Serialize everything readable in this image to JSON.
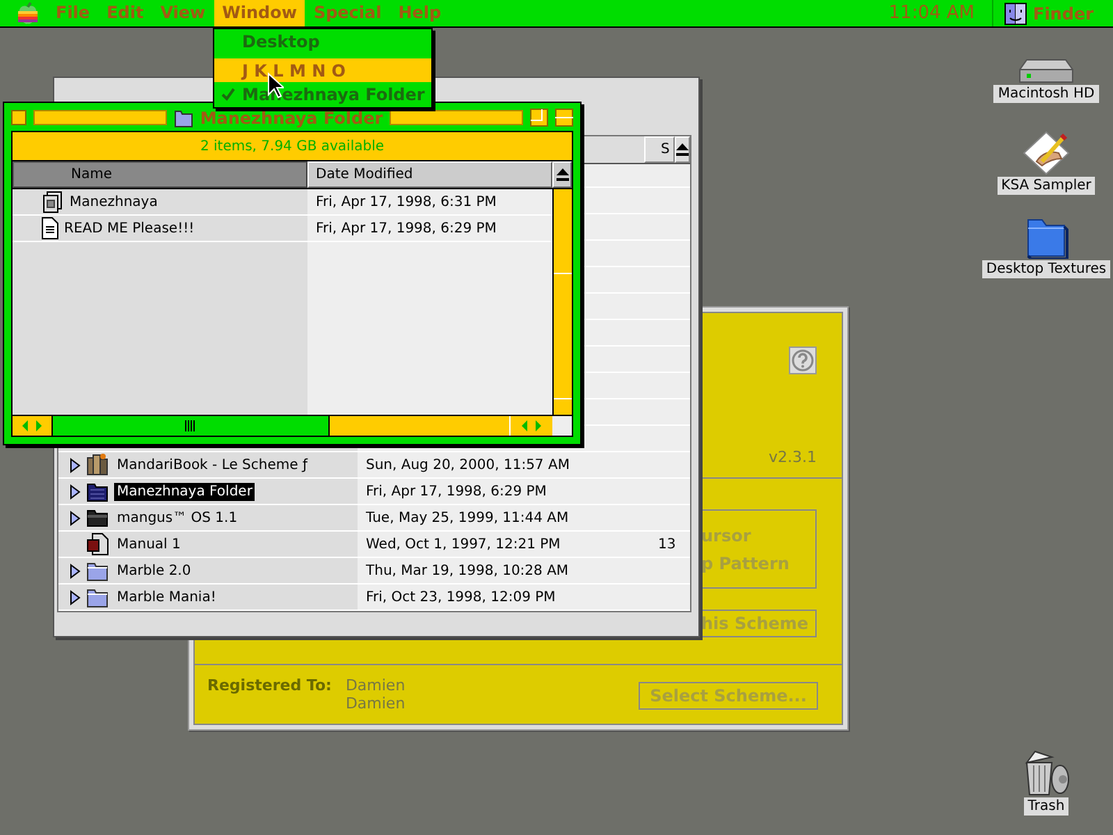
{
  "menu_bar": {
    "menus": [
      {
        "label": "File",
        "selected": false
      },
      {
        "label": "Edit",
        "selected": false
      },
      {
        "label": "View",
        "selected": false
      },
      {
        "label": "Window",
        "selected": true
      },
      {
        "label": "Special",
        "selected": false
      },
      {
        "label": "Help",
        "selected": false
      }
    ],
    "clock": "11:04 AM",
    "application": "Finder"
  },
  "window_menu": {
    "items": [
      {
        "label": "Desktop",
        "selected": false,
        "checked": false
      },
      {
        "label": "J K L M N O",
        "selected": true,
        "checked": false
      },
      {
        "label": "Manezhnaya Folder",
        "selected": false,
        "checked": true
      }
    ]
  },
  "folder_window": {
    "title": "Manezhnaya Folder",
    "info": "2 items, 7.94 GB available",
    "columns": [
      {
        "label": "Name",
        "selected": true
      },
      {
        "label": "Date Modified",
        "selected": false
      }
    ],
    "rows": [
      {
        "name": "Manezhnaya",
        "date": "Fri, Apr 17, 1998, 6:31 PM",
        "kind": "stack"
      },
      {
        "name": "READ ME Please!!!",
        "date": "Fri, Apr 17, 1998, 6:29 PM",
        "kind": "text"
      }
    ]
  },
  "list_window": {
    "column_3_header": "S",
    "rows": [
      {
        "name": "MandariBook - Le Scheme ƒ",
        "date": "Sun, Aug 20, 2000, 11:57 AM",
        "kind": "books",
        "expandable": true,
        "selected": false
      },
      {
        "name": "Manezhnaya Folder",
        "date": "Fri, Apr 17, 1998, 6:29 PM",
        "kind": "dark-folder",
        "expandable": true,
        "selected": true
      },
      {
        "name": "mangus™ OS 1.1",
        "date": "Tue, May 25, 1999, 11:44 AM",
        "kind": "black-folder",
        "expandable": true,
        "selected": false
      },
      {
        "name": "Manual 1",
        "date": "Wed, Oct 1, 1997, 12:21 PM",
        "column_3": "13",
        "kind": "document",
        "expandable": false,
        "selected": false
      },
      {
        "name": "Marble 2.0",
        "date": "Thu, Mar 19, 1998, 10:28 AM",
        "kind": "folder",
        "expandable": true,
        "selected": false
      },
      {
        "name": "Marble Mania!",
        "date": "Fri, Oct 23, 1998, 12:09 PM",
        "kind": "folder",
        "expandable": true,
        "selected": false
      }
    ]
  },
  "scheme_panel": {
    "version": "v2.3.1",
    "options": [
      "ursor",
      "p Pattern"
    ],
    "apply_button": {
      "label": "his Scheme",
      "disabled": true
    },
    "registered_label": "Registered To:",
    "registered_names": [
      "Damien",
      "Damien"
    ],
    "select_button": {
      "label": "Select Scheme...",
      "disabled": true
    }
  },
  "desktop_icons": [
    {
      "label": "Macintosh HD",
      "kind": "disk"
    },
    {
      "label": "KSA Sampler",
      "kind": "drawing"
    },
    {
      "label": "Desktop Textures",
      "kind": "folder"
    },
    {
      "label": "Trash",
      "kind": "trash"
    }
  ]
}
